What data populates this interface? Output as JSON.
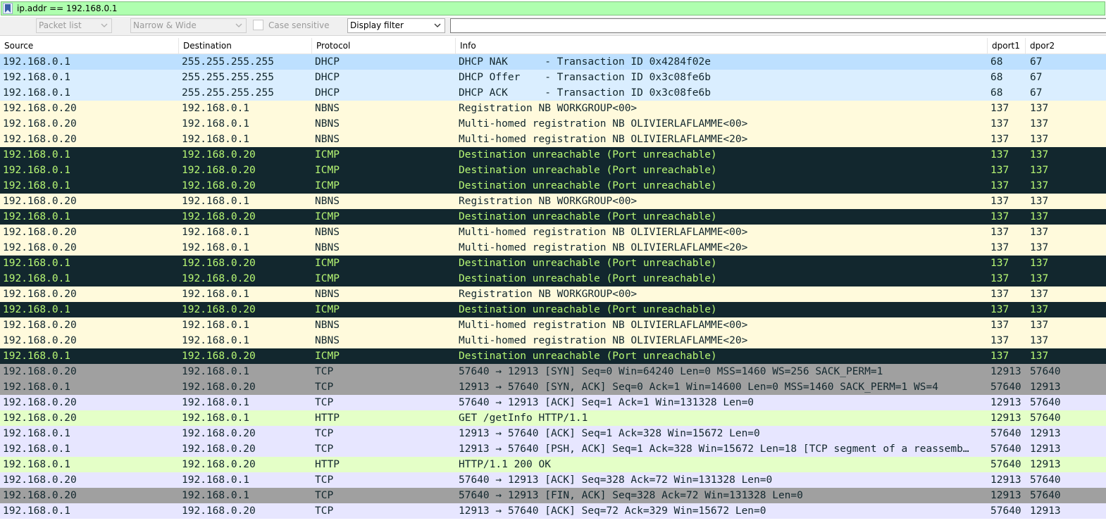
{
  "filter": {
    "value": "ip.addr == 192.168.0.1",
    "bg": "#afffaf"
  },
  "find_toolbar": {
    "search_in": "Packet list",
    "char_width": "Narrow & Wide",
    "case_sensitive_label": "Case sensitive",
    "search_type": "Display filter",
    "search_value": ""
  },
  "columns": [
    "Source",
    "Destination",
    "Protocol",
    "Info",
    "dport1",
    "dpor2"
  ],
  "colors": {
    "dhcp_selected": "#bde0ff",
    "dhcp": "#daeeff",
    "nbns": "#fffadc",
    "icmp_bg": "#12272e",
    "icmp_fg": "#b7f774",
    "tcp_syn_fin": "#a0a0a0",
    "tcp": "#e7e6ff",
    "http": "#e4ffc7"
  },
  "rows": [
    {
      "src": "192.168.0.1",
      "dst": "255.255.255.255",
      "proto": "DHCP",
      "info": "DHCP NAK      - Transaction ID 0x4284f02e",
      "dp1": "68",
      "dp2": "67",
      "bg": "#bde0ff",
      "fg": "#12272e"
    },
    {
      "src": "192.168.0.1",
      "dst": "255.255.255.255",
      "proto": "DHCP",
      "info": "DHCP Offer    - Transaction ID 0x3c08fe6b",
      "dp1": "68",
      "dp2": "67",
      "bg": "#daeeff",
      "fg": "#12272e"
    },
    {
      "src": "192.168.0.1",
      "dst": "255.255.255.255",
      "proto": "DHCP",
      "info": "DHCP ACK      - Transaction ID 0x3c08fe6b",
      "dp1": "68",
      "dp2": "67",
      "bg": "#daeeff",
      "fg": "#12272e"
    },
    {
      "src": "192.168.0.20",
      "dst": "192.168.0.1",
      "proto": "NBNS",
      "info": "Registration NB WORKGROUP<00>",
      "dp1": "137",
      "dp2": "137",
      "bg": "#fffadc",
      "fg": "#12272e"
    },
    {
      "src": "192.168.0.20",
      "dst": "192.168.0.1",
      "proto": "NBNS",
      "info": "Multi-homed registration NB OLIVIERLAFLAMME<00>",
      "dp1": "137",
      "dp2": "137",
      "bg": "#fffadc",
      "fg": "#12272e"
    },
    {
      "src": "192.168.0.20",
      "dst": "192.168.0.1",
      "proto": "NBNS",
      "info": "Multi-homed registration NB OLIVIERLAFLAMME<20>",
      "dp1": "137",
      "dp2": "137",
      "bg": "#fffadc",
      "fg": "#12272e"
    },
    {
      "src": "192.168.0.1",
      "dst": "192.168.0.20",
      "proto": "ICMP",
      "info": "Destination unreachable (Port unreachable)",
      "dp1": "137",
      "dp2": "137",
      "bg": "#12272e",
      "fg": "#b7f774"
    },
    {
      "src": "192.168.0.1",
      "dst": "192.168.0.20",
      "proto": "ICMP",
      "info": "Destination unreachable (Port unreachable)",
      "dp1": "137",
      "dp2": "137",
      "bg": "#12272e",
      "fg": "#b7f774"
    },
    {
      "src": "192.168.0.1",
      "dst": "192.168.0.20",
      "proto": "ICMP",
      "info": "Destination unreachable (Port unreachable)",
      "dp1": "137",
      "dp2": "137",
      "bg": "#12272e",
      "fg": "#b7f774"
    },
    {
      "src": "192.168.0.20",
      "dst": "192.168.0.1",
      "proto": "NBNS",
      "info": "Registration NB WORKGROUP<00>",
      "dp1": "137",
      "dp2": "137",
      "bg": "#fffadc",
      "fg": "#12272e"
    },
    {
      "src": "192.168.0.1",
      "dst": "192.168.0.20",
      "proto": "ICMP",
      "info": "Destination unreachable (Port unreachable)",
      "dp1": "137",
      "dp2": "137",
      "bg": "#12272e",
      "fg": "#b7f774"
    },
    {
      "src": "192.168.0.20",
      "dst": "192.168.0.1",
      "proto": "NBNS",
      "info": "Multi-homed registration NB OLIVIERLAFLAMME<00>",
      "dp1": "137",
      "dp2": "137",
      "bg": "#fffadc",
      "fg": "#12272e"
    },
    {
      "src": "192.168.0.20",
      "dst": "192.168.0.1",
      "proto": "NBNS",
      "info": "Multi-homed registration NB OLIVIERLAFLAMME<20>",
      "dp1": "137",
      "dp2": "137",
      "bg": "#fffadc",
      "fg": "#12272e"
    },
    {
      "src": "192.168.0.1",
      "dst": "192.168.0.20",
      "proto": "ICMP",
      "info": "Destination unreachable (Port unreachable)",
      "dp1": "137",
      "dp2": "137",
      "bg": "#12272e",
      "fg": "#b7f774"
    },
    {
      "src": "192.168.0.1",
      "dst": "192.168.0.20",
      "proto": "ICMP",
      "info": "Destination unreachable (Port unreachable)",
      "dp1": "137",
      "dp2": "137",
      "bg": "#12272e",
      "fg": "#b7f774"
    },
    {
      "src": "192.168.0.20",
      "dst": "192.168.0.1",
      "proto": "NBNS",
      "info": "Registration NB WORKGROUP<00>",
      "dp1": "137",
      "dp2": "137",
      "bg": "#fffadc",
      "fg": "#12272e"
    },
    {
      "src": "192.168.0.1",
      "dst": "192.168.0.20",
      "proto": "ICMP",
      "info": "Destination unreachable (Port unreachable)",
      "dp1": "137",
      "dp2": "137",
      "bg": "#12272e",
      "fg": "#b7f774"
    },
    {
      "src": "192.168.0.20",
      "dst": "192.168.0.1",
      "proto": "NBNS",
      "info": "Multi-homed registration NB OLIVIERLAFLAMME<00>",
      "dp1": "137",
      "dp2": "137",
      "bg": "#fffadc",
      "fg": "#12272e"
    },
    {
      "src": "192.168.0.20",
      "dst": "192.168.0.1",
      "proto": "NBNS",
      "info": "Multi-homed registration NB OLIVIERLAFLAMME<20>",
      "dp1": "137",
      "dp2": "137",
      "bg": "#fffadc",
      "fg": "#12272e"
    },
    {
      "src": "192.168.0.1",
      "dst": "192.168.0.20",
      "proto": "ICMP",
      "info": "Destination unreachable (Port unreachable)",
      "dp1": "137",
      "dp2": "137",
      "bg": "#12272e",
      "fg": "#b7f774"
    },
    {
      "src": "192.168.0.20",
      "dst": "192.168.0.1",
      "proto": "TCP",
      "info": "57640 → 12913 [SYN] Seq=0 Win=64240 Len=0 MSS=1460 WS=256 SACK_PERM=1",
      "dp1": "12913",
      "dp2": "57640",
      "bg": "#a0a0a0",
      "fg": "#12272e"
    },
    {
      "src": "192.168.0.1",
      "dst": "192.168.0.20",
      "proto": "TCP",
      "info": "12913 → 57640 [SYN, ACK] Seq=0 Ack=1 Win=14600 Len=0 MSS=1460 SACK_PERM=1 WS=4",
      "dp1": "57640",
      "dp2": "12913",
      "bg": "#a0a0a0",
      "fg": "#12272e"
    },
    {
      "src": "192.168.0.20",
      "dst": "192.168.0.1",
      "proto": "TCP",
      "info": "57640 → 12913 [ACK] Seq=1 Ack=1 Win=131328 Len=0",
      "dp1": "12913",
      "dp2": "57640",
      "bg": "#e7e6ff",
      "fg": "#12272e"
    },
    {
      "src": "192.168.0.20",
      "dst": "192.168.0.1",
      "proto": "HTTP",
      "info": "GET /getInfo HTTP/1.1",
      "dp1": "12913",
      "dp2": "57640",
      "bg": "#e4ffc7",
      "fg": "#12272e"
    },
    {
      "src": "192.168.0.1",
      "dst": "192.168.0.20",
      "proto": "TCP",
      "info": "12913 → 57640 [ACK] Seq=1 Ack=328 Win=15672 Len=0",
      "dp1": "57640",
      "dp2": "12913",
      "bg": "#e7e6ff",
      "fg": "#12272e"
    },
    {
      "src": "192.168.0.1",
      "dst": "192.168.0.20",
      "proto": "TCP",
      "info": "12913 → 57640 [PSH, ACK] Seq=1 Ack=328 Win=15672 Len=18 [TCP segment of a reassemb…",
      "dp1": "57640",
      "dp2": "12913",
      "bg": "#e7e6ff",
      "fg": "#12272e"
    },
    {
      "src": "192.168.0.1",
      "dst": "192.168.0.20",
      "proto": "HTTP",
      "info": "HTTP/1.1 200 OK",
      "dp1": "57640",
      "dp2": "12913",
      "bg": "#e4ffc7",
      "fg": "#12272e"
    },
    {
      "src": "192.168.0.20",
      "dst": "192.168.0.1",
      "proto": "TCP",
      "info": "57640 → 12913 [ACK] Seq=328 Ack=72 Win=131328 Len=0",
      "dp1": "12913",
      "dp2": "57640",
      "bg": "#e7e6ff",
      "fg": "#12272e"
    },
    {
      "src": "192.168.0.20",
      "dst": "192.168.0.1",
      "proto": "TCP",
      "info": "57640 → 12913 [FIN, ACK] Seq=328 Ack=72 Win=131328 Len=0",
      "dp1": "12913",
      "dp2": "57640",
      "bg": "#a0a0a0",
      "fg": "#12272e"
    },
    {
      "src": "192.168.0.1",
      "dst": "192.168.0.20",
      "proto": "TCP",
      "info": "12913 → 57640 [ACK] Seq=72 Ack=329 Win=15672 Len=0",
      "dp1": "57640",
      "dp2": "12913",
      "bg": "#e7e6ff",
      "fg": "#12272e"
    }
  ]
}
